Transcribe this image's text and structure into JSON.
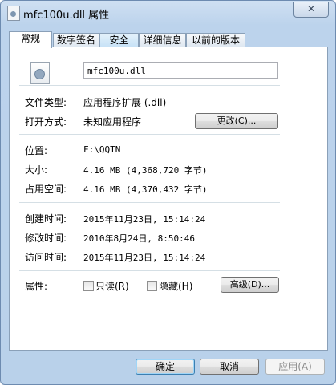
{
  "window": {
    "title": "mfc100u.dll 属性",
    "close_icon": "close-icon",
    "close_glyph": "✕"
  },
  "tabs": [
    {
      "label": "常规",
      "active": true
    },
    {
      "label": "数字签名",
      "active": false
    },
    {
      "label": "安全",
      "active": false
    },
    {
      "label": "详细信息",
      "active": false
    },
    {
      "label": "以前的版本",
      "active": false
    }
  ],
  "general": {
    "file_name": "mfc100u.dll",
    "file_type_label": "文件类型:",
    "file_type_value": "应用程序扩展 (.dll)",
    "open_with_label": "打开方式:",
    "open_with_value": "未知应用程序",
    "change_button": "更改(C)...",
    "location_label": "位置:",
    "location_value": "F:\\QQTN",
    "size_label": "大小:",
    "size_value": "4.16 MB (4,368,720 字节)",
    "size_on_disk_label": "占用空间:",
    "size_on_disk_value": "4.16 MB (4,370,432 字节)",
    "created_label": "创建时间:",
    "created_value": "2015年11月23日, 15:14:24",
    "modified_label": "修改时间:",
    "modified_value": "2010年8月24日, 8:50:46",
    "accessed_label": "访问时间:",
    "accessed_value": "2015年11月23日, 15:14:24",
    "attributes_label": "属性:",
    "readonly_label": "只读(R)",
    "hidden_label": "隐藏(H)",
    "advanced_button": "高级(D)..."
  },
  "footer": {
    "ok_button": "确定",
    "cancel_button": "取消",
    "apply_button": "应用(A)"
  }
}
